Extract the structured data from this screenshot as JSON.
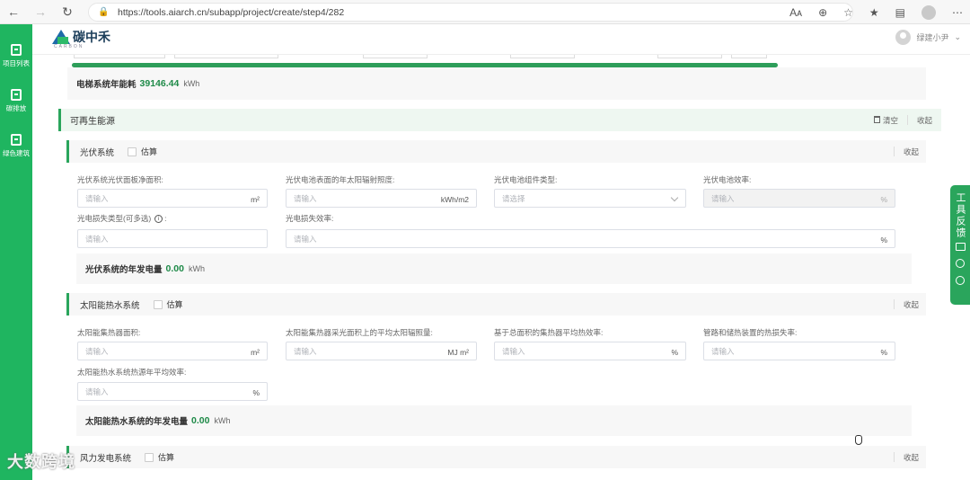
{
  "browser": {
    "url": "https://tools.aiarch.cn/subapp/project/create/step4/282",
    "read_aloud": "Aᴀ"
  },
  "sidebar": {
    "items": [
      {
        "label": "项目列表"
      },
      {
        "label": "碳排放"
      },
      {
        "label": "绿色建筑"
      }
    ]
  },
  "header": {
    "logo_text": "碳中禾",
    "logo_sub": "CARBON",
    "user_name": "绿建小尹"
  },
  "elevator": {
    "label": "电梯系统年能耗",
    "value": "39146.44",
    "unit": "kWh",
    "progress": 1.0
  },
  "renewable": {
    "title": "可再生能源",
    "clear_label": "清空",
    "collapse_label": "收起"
  },
  "pv": {
    "title": "光伏系统",
    "estimate_label": "估算",
    "collapse_label": "收起",
    "fields": {
      "area_label": "光伏系统光伏面板净面积:",
      "area_placeholder": "请输入",
      "area_unit": "m²",
      "irradiance_label": "光伏电池表面的年太阳辐射照度:",
      "irradiance_placeholder": "请输入",
      "irradiance_unit": "kWh/m2",
      "module_label": "光伏电池组件类型:",
      "module_placeholder": "请选择",
      "efficiency_label": "光伏电池效率:",
      "efficiency_placeholder": "请输入",
      "efficiency_unit": "%",
      "loss_type_label": "光电损失类型(可多选)",
      "loss_type_placeholder": "请输入",
      "loss_eff_label": "光电损失效率:",
      "loss_eff_placeholder": "请输入",
      "loss_eff_unit": "%"
    },
    "result_label": "光伏系统的年发电量",
    "result_value": "0.00",
    "result_unit": "kWh"
  },
  "solar_water": {
    "title": "太阳能热水系统",
    "estimate_label": "估算",
    "collapse_label": "收起",
    "fields": {
      "area_label": "太阳能集热器面积:",
      "area_placeholder": "请输入",
      "area_unit": "m²",
      "radiation_label": "太阳能集热器采光面积上的平均太阳辐照量:",
      "radiation_placeholder": "请输入",
      "radiation_unit": "MJ m²",
      "collector_eff_label": "基于总面积的集热器平均热效率:",
      "collector_eff_placeholder": "请输入",
      "collector_eff_unit": "%",
      "pipe_loss_label": "管路和储热装置的热损失率:",
      "pipe_loss_placeholder": "请输入",
      "pipe_loss_unit": "%",
      "source_eff_label": "太阳能热水系统热源年平均效率:",
      "source_eff_placeholder": "请输入",
      "source_eff_unit": "%"
    },
    "result_label": "太阳能热水系统的年发电量",
    "result_value": "0.00",
    "result_unit": "kWh"
  },
  "third": {
    "title": "风力发电系统",
    "estimate_label": "估算",
    "collapse_label": "收起"
  },
  "feedback": {
    "label": "工具反馈"
  },
  "watermark": "大数跨境",
  "colors": {
    "brand_green": "#1fb560",
    "accent_green": "#2aa55c",
    "value_green": "#1e8a48"
  }
}
